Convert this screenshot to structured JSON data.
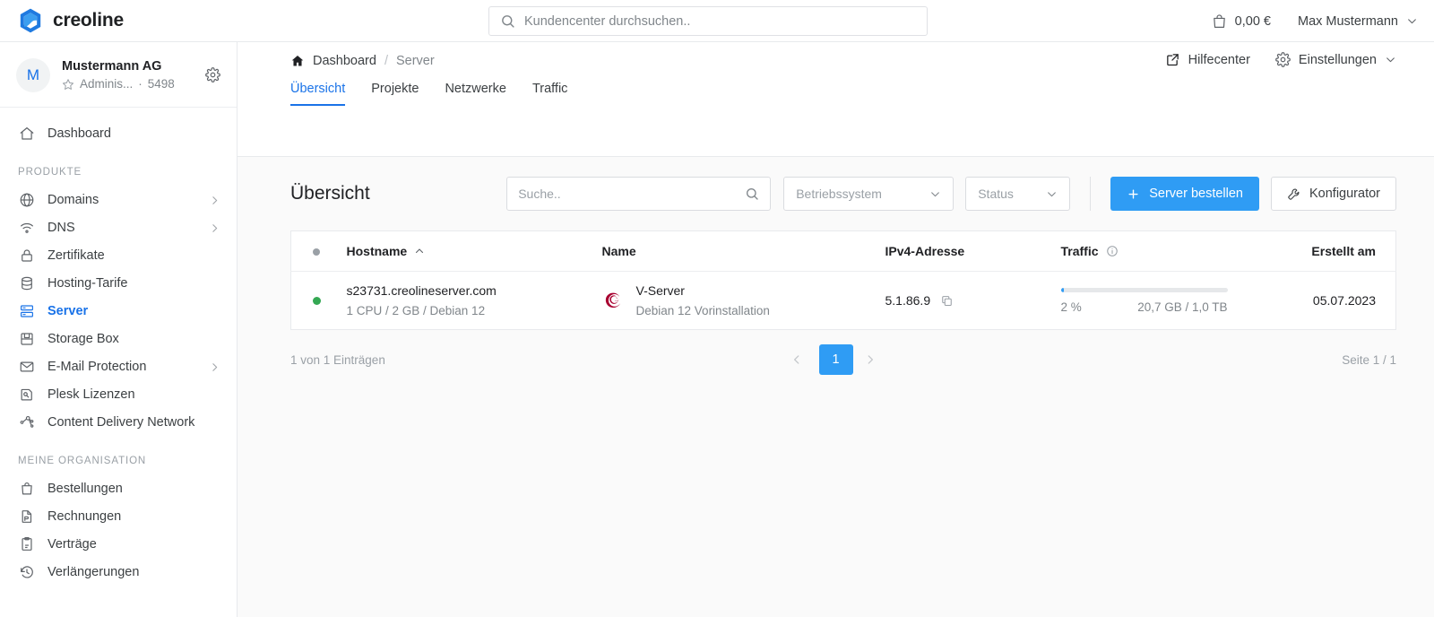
{
  "topbar": {
    "brand": "creoline",
    "brand_mark": "creoline-logo",
    "search": {
      "placeholder": "Kundencenter durchsuchen..",
      "value": "",
      "icon": "search-icon"
    },
    "cart": {
      "icon": "shopping-bag-icon",
      "amount": "0,00 €"
    },
    "user": {
      "name": "Max Mustermann",
      "icon": "chevron-down-icon"
    }
  },
  "sidebar": {
    "org": {
      "avatar_letter": "M",
      "name": "Mustermann AG",
      "role": "Adminis...",
      "separator": "·",
      "customer_id": "5498",
      "star_icon": "star-icon",
      "gear_icon": "gear-icon"
    },
    "top_items": [
      {
        "label": "Dashboard",
        "icon": "home-icon",
        "active": false,
        "expandable": false
      }
    ],
    "sections": [
      {
        "title": "PRODUKTE",
        "items": [
          {
            "label": "Domains",
            "icon": "globe-icon",
            "active": false,
            "expandable": true
          },
          {
            "label": "DNS",
            "icon": "wifi-icon",
            "active": false,
            "expandable": true
          },
          {
            "label": "Zertifikate",
            "icon": "lock-icon",
            "active": false,
            "expandable": false
          },
          {
            "label": "Hosting-Tarife",
            "icon": "database-icon",
            "active": false,
            "expandable": false
          },
          {
            "label": "Server",
            "icon": "server-icon",
            "active": true,
            "expandable": false
          },
          {
            "label": "Storage Box",
            "icon": "save-icon",
            "active": false,
            "expandable": false
          },
          {
            "label": "E-Mail Protection",
            "icon": "mail-icon",
            "active": false,
            "expandable": true
          },
          {
            "label": "Plesk Lizenzen",
            "icon": "license-icon",
            "active": false,
            "expandable": false
          },
          {
            "label": "Content Delivery Network",
            "icon": "network-icon",
            "active": false,
            "expandable": false
          }
        ]
      },
      {
        "title": "MEINE ORGANISATION",
        "items": [
          {
            "label": "Bestellungen",
            "icon": "bag-icon",
            "active": false,
            "expandable": false
          },
          {
            "label": "Rechnungen",
            "icon": "invoice-icon",
            "active": false,
            "expandable": false
          },
          {
            "label": "Verträge",
            "icon": "contract-icon",
            "active": false,
            "expandable": false
          },
          {
            "label": "Verlängerungen",
            "icon": "history-icon",
            "active": false,
            "expandable": false
          }
        ]
      }
    ]
  },
  "breadcrumb": {
    "home_icon": "home-icon",
    "items": [
      "Dashboard",
      "Server"
    ],
    "separator": "/"
  },
  "header_actions": [
    {
      "label": "Hilfecenter",
      "icon": "external-link-icon"
    },
    {
      "label": "Einstellungen",
      "icon": "gear-icon",
      "caret": "chevron-down-icon"
    }
  ],
  "tabs": [
    {
      "label": "Übersicht",
      "active": true
    },
    {
      "label": "Projekte",
      "active": false
    },
    {
      "label": "Netzwerke",
      "active": false
    },
    {
      "label": "Traffic",
      "active": false
    }
  ],
  "panel": {
    "title": "Übersicht",
    "search": {
      "placeholder": "Suche..",
      "value": "",
      "icon": "search-icon"
    },
    "filters": [
      {
        "name": "os-filter",
        "label": "Betriebssystem",
        "caret": "chevron-down-icon"
      },
      {
        "name": "status-filter",
        "label": "Status",
        "caret": "chevron-down-icon"
      }
    ],
    "primary_button": {
      "label": "Server bestellen",
      "icon": "plus-icon"
    },
    "secondary_button": {
      "label": "Konfigurator",
      "icon": "wrench-icon"
    }
  },
  "table": {
    "columns": [
      {
        "key": "status",
        "label": "",
        "icon": "status-dot-icon"
      },
      {
        "key": "hostname",
        "label": "Hostname",
        "sort": "asc",
        "sort_icon": "chevron-up-icon"
      },
      {
        "key": "name",
        "label": "Name"
      },
      {
        "key": "ipv4",
        "label": "IPv4-Adresse"
      },
      {
        "key": "traffic",
        "label": "Traffic",
        "info_icon": "info-icon"
      },
      {
        "key": "created",
        "label": "Erstellt am"
      }
    ],
    "rows": [
      {
        "status": "online",
        "status_color": "#34a853",
        "hostname": "s23731.creolineserver.com",
        "specs": "1 CPU / 2 GB / Debian 12",
        "os_icon": "debian-icon",
        "name": "V-Server",
        "name_sub": "Debian 12 Vorinstallation",
        "ipv4": "5.1.86.9",
        "copy_icon": "copy-icon",
        "traffic_percent_label": "2 %",
        "traffic_percent": 2,
        "traffic_usage": "20,7 GB / 1,0 TB",
        "created": "05.07.2023"
      }
    ]
  },
  "pagination": {
    "count_text": "1 von 1 Einträgen",
    "prev_icon": "chevron-left-icon",
    "next_icon": "chevron-right-icon",
    "current_page": "1",
    "page_info": "Seite 1 / 1"
  },
  "colors": {
    "accent": "#1a73e8",
    "button_blue": "#2f9cf4",
    "online_green": "#34a853",
    "debian_red": "#a80030",
    "muted": "#80868b"
  }
}
